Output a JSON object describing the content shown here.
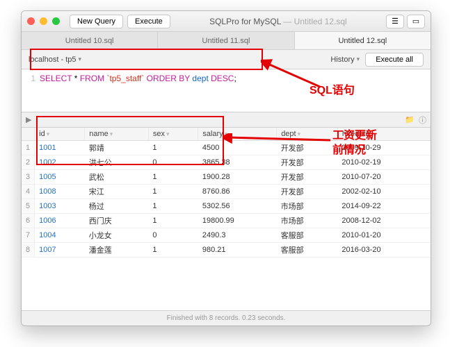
{
  "window": {
    "title_app": "SQLPro for MySQL",
    "title_doc": " — Untitled 12.sql",
    "new_query": "New Query",
    "execute": "Execute"
  },
  "tabs": {
    "t0": "Untitled 10.sql",
    "t1": "Untitled 11.sql",
    "t2": "Untitled 12.sql"
  },
  "subbar": {
    "connection": "localhost - tp5",
    "history": "History",
    "execute_all": "Execute all"
  },
  "sql": {
    "line_no": "1",
    "kw_select": "SELECT",
    "star": " * ",
    "kw_from": "FROM",
    "table": " `tp5_staff` ",
    "kw_orderby": "ORDER BY",
    "col": " dept ",
    "kw_desc": "DESC",
    "semi": ";"
  },
  "midbar": {
    "arrow": "▶"
  },
  "table": {
    "headers": {
      "id": "id",
      "name": "name",
      "sex": "sex",
      "salary": "salary",
      "dept": "dept",
      "hiredate": "hiredate"
    },
    "rows": [
      {
        "n": "1",
        "id": "1001",
        "name": "郭靖",
        "sex": "1",
        "salary": "4500",
        "dept": "开发部",
        "hiredate": "2009-10-29"
      },
      {
        "n": "2",
        "id": "1002",
        "name": "洪七公",
        "sex": "0",
        "salary": "3865.38",
        "dept": "开发部",
        "hiredate": "2010-02-19"
      },
      {
        "n": "3",
        "id": "1005",
        "name": "武松",
        "sex": "1",
        "salary": "1900.28",
        "dept": "开发部",
        "hiredate": "2010-07-20"
      },
      {
        "n": "4",
        "id": "1008",
        "name": "宋江",
        "sex": "1",
        "salary": "8760.86",
        "dept": "开发部",
        "hiredate": "2002-02-10"
      },
      {
        "n": "5",
        "id": "1003",
        "name": "杨过",
        "sex": "1",
        "salary": "5302.56",
        "dept": "市场部",
        "hiredate": "2014-09-22"
      },
      {
        "n": "6",
        "id": "1006",
        "name": "西门庆",
        "sex": "1",
        "salary": "19800.99",
        "dept": "市场部",
        "hiredate": "2008-12-02"
      },
      {
        "n": "7",
        "id": "1004",
        "name": "小龙女",
        "sex": "0",
        "salary": "2490.3",
        "dept": "客服部",
        "hiredate": "2010-01-20"
      },
      {
        "n": "8",
        "id": "1007",
        "name": "潘金莲",
        "sex": "1",
        "salary": "980.21",
        "dept": "客服部",
        "hiredate": "2016-03-20"
      }
    ]
  },
  "status": {
    "text": "Finished with 8 records. 0.23 seconds."
  },
  "annotations": {
    "sql_label": "SQL语句",
    "salary_label_l1": "工资更新",
    "salary_label_l2": "前情况"
  }
}
